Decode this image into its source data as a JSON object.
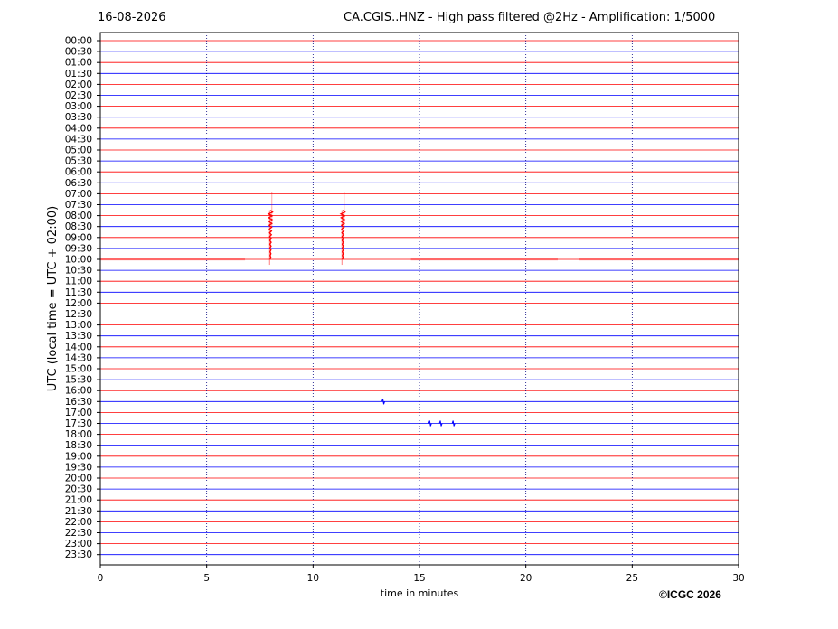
{
  "header": {
    "date": "16-08-2026",
    "title": "CA.CGIS..HNZ - High pass filtered @2Hz - Amplification: 1/5000"
  },
  "footer": {
    "copyright": "©ICGC 2026"
  },
  "colors": {
    "trace_a": "#ff0000",
    "trace_b": "#0000ff",
    "grid": "#00007f",
    "frame": "#000000"
  },
  "chart_data": {
    "type": "line",
    "xlabel": "time in minutes",
    "ylabel": "UTC (local time = UTC + 02:00)",
    "xlim": [
      0,
      30
    ],
    "x_ticks": [
      0,
      5,
      10,
      15,
      20,
      25,
      30
    ],
    "grid": "vertical dotted lines at x ticks",
    "rows": [
      "00:00",
      "00:30",
      "01:00",
      "01:30",
      "02:00",
      "02:30",
      "03:00",
      "03:30",
      "04:00",
      "04:30",
      "05:00",
      "05:30",
      "06:00",
      "06:30",
      "07:00",
      "07:30",
      "08:00",
      "08:30",
      "09:00",
      "09:30",
      "10:00",
      "10:30",
      "11:00",
      "11:30",
      "12:00",
      "12:30",
      "13:00",
      "13:30",
      "14:00",
      "14:30",
      "15:00",
      "15:30",
      "16:00",
      "16:30",
      "17:00",
      "17:30",
      "18:00",
      "18:30",
      "19:00",
      "19:30",
      "20:00",
      "20:30",
      "21:00",
      "21:30",
      "22:00",
      "22:30",
      "23:00",
      "23:30"
    ],
    "trace_color_pattern": [
      "red",
      "blue"
    ],
    "events": [
      {
        "row": "07:00",
        "minute": 8.0,
        "span_rows": 7,
        "color": "red",
        "strength": "strong"
      },
      {
        "row": "07:00",
        "minute": 11.4,
        "span_rows": 7,
        "color": "red",
        "strength": "strong"
      },
      {
        "row": "10:00",
        "minute_start": 0.0,
        "minute_end": 6.8,
        "color": "red",
        "strength": "noise band"
      },
      {
        "row": "10:00",
        "minute_start": 14.6,
        "minute_end": 21.5,
        "color": "red",
        "strength": "noise band"
      },
      {
        "row": "10:00",
        "minute_start": 22.5,
        "minute_end": 30.0,
        "color": "red",
        "strength": "noise band"
      },
      {
        "row": "16:30",
        "minute": 13.3,
        "color": "blue",
        "strength": "small"
      },
      {
        "row": "17:30",
        "minute": 15.5,
        "color": "blue",
        "strength": "small"
      },
      {
        "row": "17:30",
        "minute": 16.0,
        "color": "blue",
        "strength": "small"
      },
      {
        "row": "17:30",
        "minute": 16.6,
        "color": "blue",
        "strength": "small"
      }
    ]
  }
}
